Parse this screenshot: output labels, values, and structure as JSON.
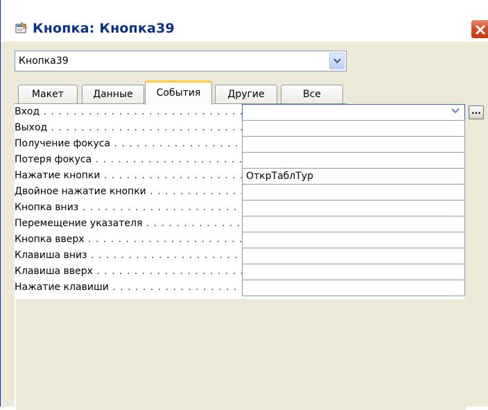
{
  "window": {
    "title": "Кнопка: Кнопка39"
  },
  "object_select": {
    "value": "Кнопка39"
  },
  "tabs": [
    {
      "label": "Макет"
    },
    {
      "label": "Данные"
    },
    {
      "label": "События"
    },
    {
      "label": "Другие"
    },
    {
      "label": "Все"
    }
  ],
  "active_tab": "События",
  "properties": [
    {
      "label": "Вход",
      "value": ""
    },
    {
      "label": "Выход",
      "value": ""
    },
    {
      "label": "Получение фокуса",
      "value": ""
    },
    {
      "label": "Потеря фокуса",
      "value": ""
    },
    {
      "label": "Нажатие кнопки",
      "value": "ОткрТаблТур"
    },
    {
      "label": "Двойное нажатие кнопки",
      "value": ""
    },
    {
      "label": "Кнопка вниз",
      "value": ""
    },
    {
      "label": "Перемещение указателя",
      "value": ""
    },
    {
      "label": "Кнопка вверх",
      "value": ""
    },
    {
      "label": "Клавиша вниз",
      "value": ""
    },
    {
      "label": "Клавиша вверх",
      "value": ""
    },
    {
      "label": "Нажатие клавиши",
      "value": ""
    }
  ],
  "build_button": {
    "label": "..."
  },
  "icons": {
    "window": "properties-window-icon",
    "close": "close-icon",
    "dropdown": "chevron-down-icon"
  },
  "colors": {
    "title_text": "#0b2f8a",
    "close_button": "#d04a20",
    "active_tab_accent": "#ffc83c",
    "field_border": "#7f9db9",
    "panel_background": "#ece9d8"
  }
}
